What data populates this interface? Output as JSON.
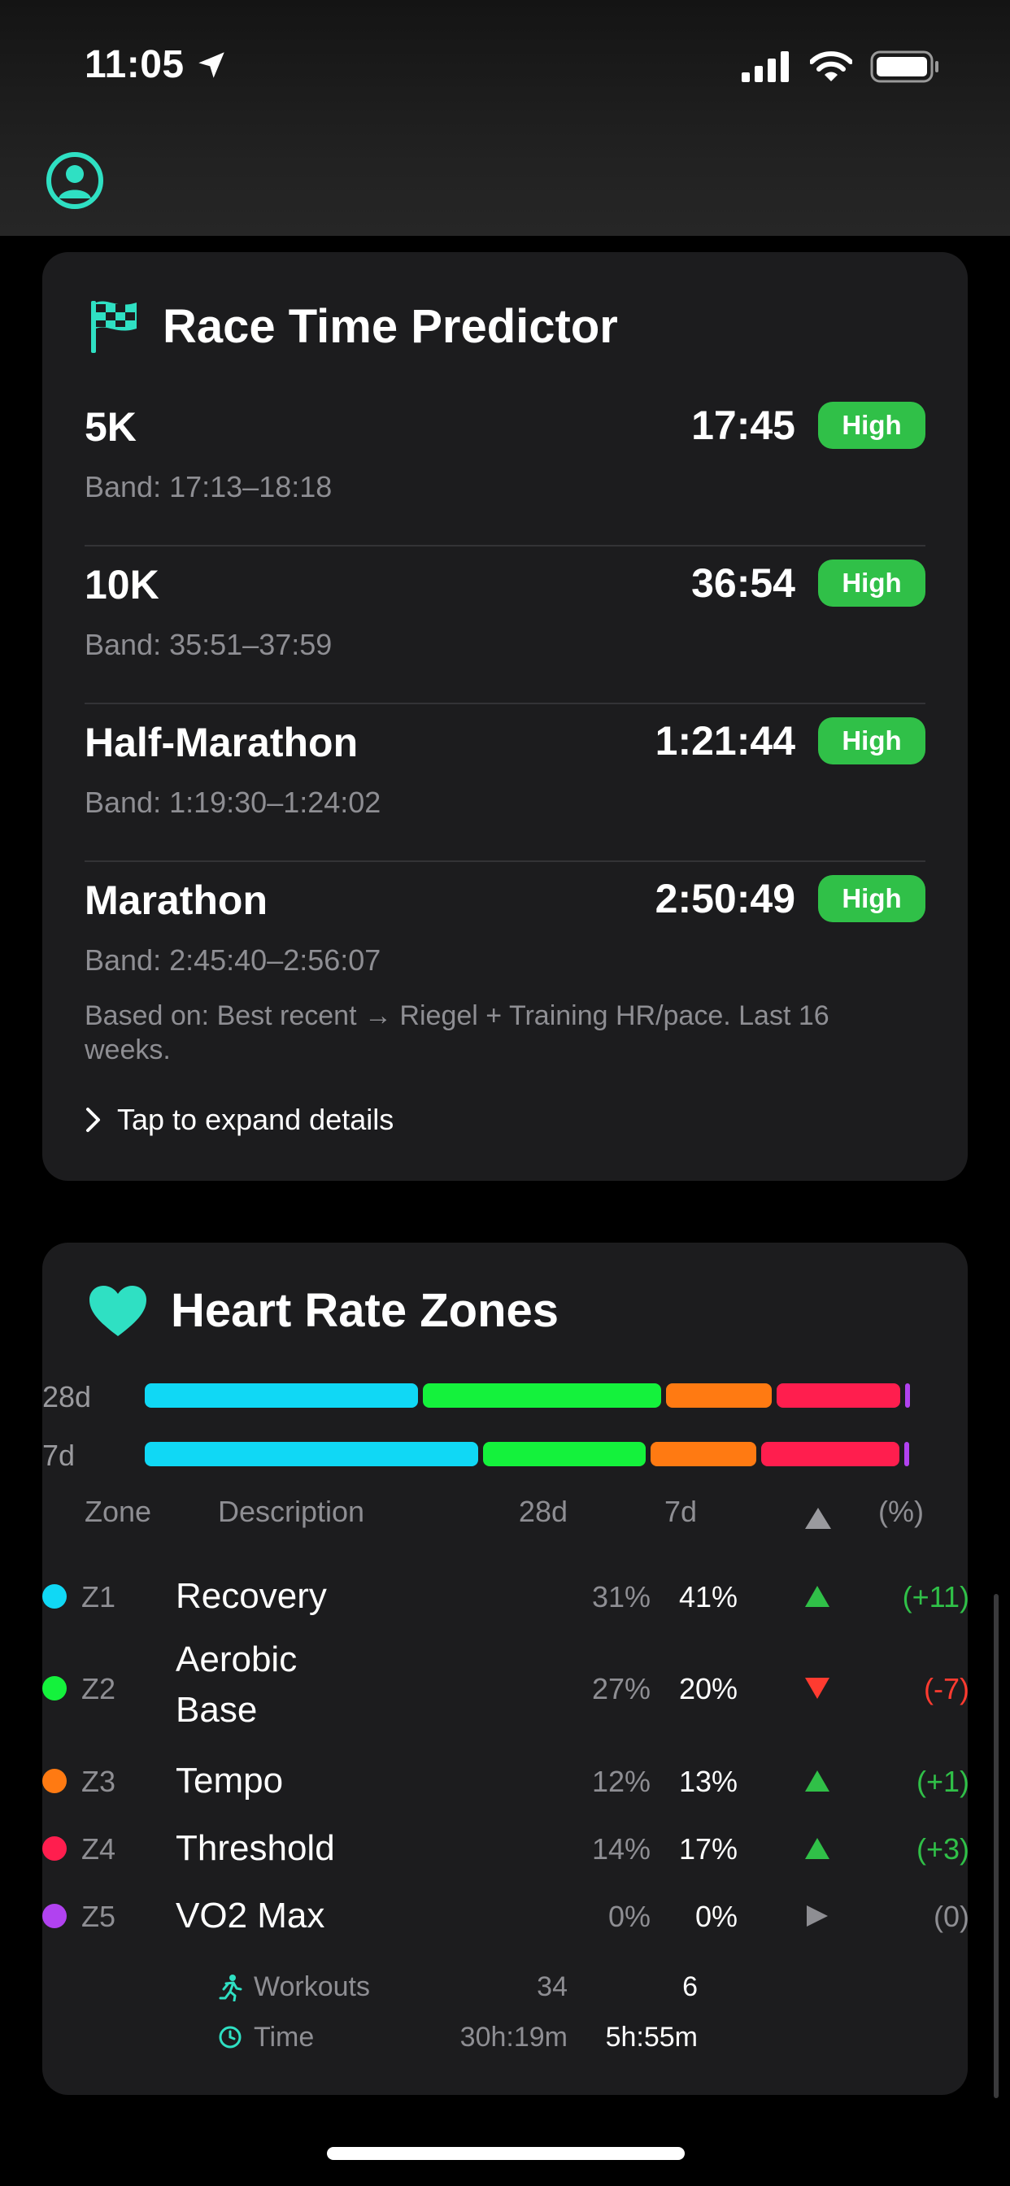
{
  "status_bar": {
    "time": "11:05"
  },
  "race": {
    "title": "Race Time Predictor",
    "rows": [
      {
        "name": "5K",
        "band": "Band: 17:13–18:18",
        "prediction": "17:45",
        "confidence": "High"
      },
      {
        "name": "10K",
        "band": "Band: 35:51–37:59",
        "prediction": "36:54",
        "confidence": "High"
      },
      {
        "name": "Half-Marathon",
        "band": "Band: 1:19:30–1:24:02",
        "prediction": "1:21:44",
        "confidence": "High"
      },
      {
        "name": "Marathon",
        "band": "Band: 2:45:40–2:56:07",
        "prediction": "2:50:49",
        "confidence": "High"
      }
    ],
    "basis": "Based on: Best recent → Riegel + Training HR/pace. Last 16 weeks.",
    "expand": "Tap to expand details"
  },
  "hr": {
    "title": "Heart Rate Zones",
    "bars": [
      {
        "label": "28d",
        "values": [
          31,
          27,
          12,
          14,
          0
        ]
      },
      {
        "label": "7d",
        "values": [
          41,
          20,
          13,
          17,
          0
        ]
      }
    ],
    "colors": [
      "#10d8f5",
      "#14f23c",
      "#ff7a12",
      "#ff1e4e",
      "#b142f0"
    ],
    "headers": {
      "zone": "Zone",
      "description": "Description",
      "d28": "28d",
      "d7": "7d",
      "pct": "(%)"
    },
    "zones": [
      {
        "code": "Z1",
        "desc": "Recovery",
        "d28": "31%",
        "d7": "41%",
        "trend": "up",
        "delta": "(+11)"
      },
      {
        "code": "Z2",
        "desc": "Aerobic Base",
        "d28": "27%",
        "d7": "20%",
        "trend": "down",
        "delta": "(-7)"
      },
      {
        "code": "Z3",
        "desc": "Tempo",
        "d28": "12%",
        "d7": "13%",
        "trend": "up",
        "delta": "(+1)"
      },
      {
        "code": "Z4",
        "desc": "Threshold",
        "d28": "14%",
        "d7": "17%",
        "trend": "up",
        "delta": "(+3)"
      },
      {
        "code": "Z5",
        "desc": "VO2 Max",
        "d28": "0%",
        "d7": "0%",
        "trend": "flat",
        "delta": "(0)"
      }
    ],
    "workouts": {
      "label": "Workouts",
      "d28": "34",
      "d7": "6"
    },
    "time": {
      "label": "Time",
      "d28": "30h:19m",
      "d7": "5h:55m"
    }
  }
}
